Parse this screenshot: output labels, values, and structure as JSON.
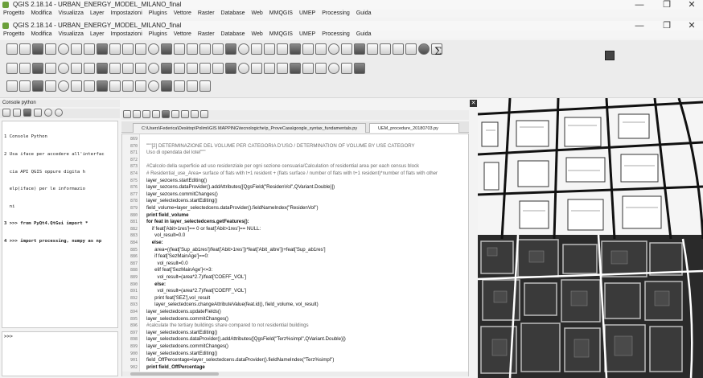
{
  "window_back": {
    "title": "QGIS 2.18.14 - URBAN_ENERGY_MODEL_MILANO_final",
    "menu": [
      "Progetto",
      "Modifica",
      "Visualizza",
      "Layer",
      "Impostazioni",
      "Plugins",
      "Vettore",
      "Raster",
      "Database",
      "Web",
      "MMQGIS",
      "UMEP",
      "Processing",
      "Guida"
    ]
  },
  "window": {
    "title": "QGIS 2.18.14 - URBAN_ENERGY_MODEL_MILANO_final",
    "menu": [
      "Progetto",
      "Modifica",
      "Visualizza",
      "Layer",
      "Impostazioni",
      "Plugins",
      "Vettore",
      "Raster",
      "Database",
      "Web",
      "MMQGIS",
      "UMEP",
      "Processing",
      "Guida"
    ],
    "controls": {
      "minimize": "—",
      "maximize": "❐",
      "close": "✕"
    }
  },
  "toolbar": {
    "sum_symbol": "Σ"
  },
  "python_console": {
    "header": "Console python",
    "output_lines": [
      "1 Console Python",
      "2 Usa iface per accedere all'interfac",
      "  cia API QGIS oppure digita h",
      "  elp(iface) per le informazio",
      "  ni",
      "3 >>> from PyQt4.QtGui import *",
      "4 >>> import processing, numpy as np"
    ],
    "prompt": ">>>"
  },
  "editor": {
    "tabs": [
      {
        "label": "C:\\Users\\Federica\\Desktop\\Polimi\\GIS MAPPING\\tecnologiche\\p_ProveCasa\\google_syntax_fundamentals.py",
        "active": false
      },
      {
        "label": "UEM_procedure_20180703.py",
        "active": true
      }
    ],
    "lines": [
      {
        "n": "869",
        "text": "",
        "cls": ""
      },
      {
        "n": "870",
        "text": "\"\"\"[2] DETERMINAZIONE DEL VOLUME PER CATEGORIA D'USO / DETERMINATION OF VOLUME BY USE CATEGORY",
        "cls": "cm"
      },
      {
        "n": "871",
        "text": "Uso di opendata del lotel\"\"\"",
        "cls": "cm"
      },
      {
        "n": "872",
        "text": "",
        "cls": ""
      },
      {
        "n": "873",
        "text": "#Calcolo della superficie ad uso residenziale per ogni sezione censuaria/Calculation of residential area per each census block",
        "cls": "cm"
      },
      {
        "n": "874",
        "text": "# Residential_use_Area= surface of flats with t+1 resident + (flats surface / number of flats with t+1 resident)*number of flats with other",
        "cls": "cm"
      },
      {
        "n": "875",
        "text": "layer_sezcens.startEditing()",
        "cls": ""
      },
      {
        "n": "876",
        "text": "layer_sezcens.dataProvider().addAttributes([QgsField(\"ResidenVol\",QVariant.Double)])",
        "cls": ""
      },
      {
        "n": "877",
        "text": "layer_sezcens.commitChanges()",
        "cls": ""
      },
      {
        "n": "878",
        "text": "layer_selectedcens.startEditing()",
        "cls": ""
      },
      {
        "n": "879",
        "text": "field_volume=layer_selectedcens.dataProvider().fieldNameIndex(\"ResidenVol\")",
        "cls": ""
      },
      {
        "n": "880",
        "text": "print field_volume",
        "cls": "kw"
      },
      {
        "n": "881",
        "text": "for feat in layer_selectedcens.getFeatures():",
        "cls": "kw"
      },
      {
        "n": "882",
        "text": "    if feat['Abit>1res']== 0 or feat['Abit>1res']== NULL:",
        "cls": ""
      },
      {
        "n": "883",
        "text": "      vol_result=0.0",
        "cls": ""
      },
      {
        "n": "884",
        "text": "    else:",
        "cls": "kw"
      },
      {
        "n": "885",
        "text": "      area=((feat['Sup_ab1res']/feat['Abit>1res'])*feat['Abit_altre'])+feat['Sup_ab1res']",
        "cls": ""
      },
      {
        "n": "886",
        "text": "      if feat['SezMainAge']==0:",
        "cls": ""
      },
      {
        "n": "887",
        "text": "        vol_result=0.0",
        "cls": ""
      },
      {
        "n": "888",
        "text": "      elif feat['SezMainAge']<=3:",
        "cls": ""
      },
      {
        "n": "889",
        "text": "        vol_result=(area*2.7)/feat['COEFF_VOL']",
        "cls": ""
      },
      {
        "n": "890",
        "text": "      else:",
        "cls": "kw"
      },
      {
        "n": "891",
        "text": "        vol_result=(area*2.7)/feat['COEFF_VOL']",
        "cls": ""
      },
      {
        "n": "892",
        "text": "      print feat['SEZ'],vol_result",
        "cls": ""
      },
      {
        "n": "893",
        "text": "      layer_selectedcens.changeAttributeValue(feat.id(), field_volume, vol_result)",
        "cls": ""
      },
      {
        "n": "894",
        "text": "layer_selectedcens.updateFields()",
        "cls": ""
      },
      {
        "n": "895",
        "text": "layer_selectedcens.commitChanges()",
        "cls": ""
      },
      {
        "n": "896",
        "text": "#calculate the tertiary buildings share compared to not residential buildings",
        "cls": "cm"
      },
      {
        "n": "897",
        "text": "layer_selectedcens.startEditing()",
        "cls": ""
      },
      {
        "n": "898",
        "text": "layer_selectedcens.dataProvider().addAttributes([QgsField(\"Terz%simpl\",QVariant.Double)])",
        "cls": ""
      },
      {
        "n": "899",
        "text": "layer_selectedcens.commitChanges()",
        "cls": ""
      },
      {
        "n": "900",
        "text": "layer_selectedcens.startEditing()",
        "cls": ""
      },
      {
        "n": "901",
        "text": "field_OffPercentage=layer_selectedcens.dataProvider().fieldNameIndex(\"Terz%simpl\")",
        "cls": ""
      },
      {
        "n": "902",
        "text": "print field_OffPercentage",
        "cls": "kw"
      }
    ]
  }
}
